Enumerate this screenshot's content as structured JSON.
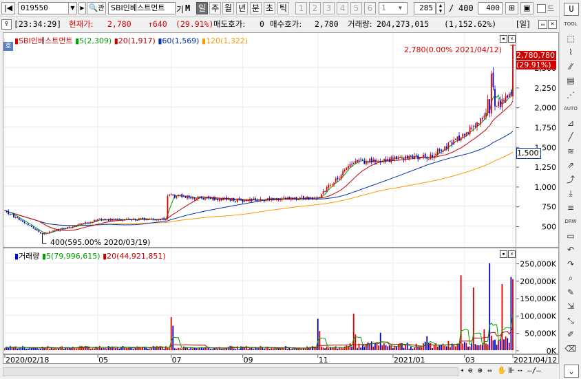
{
  "toolbar": {
    "code": "019550",
    "name": "SBI인베스트먼트",
    "name_tag": "기",
    "market_tag": "M",
    "periods": [
      "일",
      "주",
      "월",
      "년",
      "분",
      "초",
      "틱"
    ],
    "selected_period": "일",
    "interval_buttons": [
      "1",
      "2",
      "3",
      "4",
      "5",
      "6"
    ],
    "interval_value": "1",
    "view_count": "285",
    "view_total": "400",
    "view_max": "400"
  },
  "info": {
    "time": "[23:34:29]",
    "price_label": "현재가:",
    "price": "2,780",
    "change": "↑640",
    "change_pct": "(29.91%)",
    "ask_label": "매도호가:",
    "ask": "0",
    "bid_label": "매수호가:",
    "bid": "2,780",
    "volume_label": "거래량:",
    "volume": "204,273,015",
    "volume_pct": "(1,152.62%)",
    "period_tag": "[일]"
  },
  "price_legend": {
    "name": "SBI인베스트먼트",
    "ma5": "5(2,309)",
    "ma20": "20(1,917)",
    "ma60": "60(1,569)",
    "ma120": "120(1,322)",
    "badge": "호"
  },
  "volume_legend": {
    "name": "거래량",
    "ma5": "5(79,996,615)",
    "ma20": "20(44,921,851)"
  },
  "annotations": {
    "high": "2,780(0.00% 2021/04/12)",
    "low": "400(595.00% 2020/03/19)",
    "current_price_tag": "2,780,780",
    "current_pct_tag": "(29.91%)",
    "ma_tag": "1,500"
  },
  "x_labels": [
    "2020/02/18",
    "05",
    "07",
    "09",
    "11",
    "2021/01",
    "03",
    "2021/04/12"
  ],
  "colors": {
    "up": "#d40000",
    "down": "#0000cc",
    "ma5": "#00a000",
    "ma20": "#c00000",
    "ma60": "#0033aa",
    "ma120": "#ff9900"
  },
  "sidebar": [
    "TOOL",
    "zoom",
    "chart",
    "compare",
    "find",
    "trend",
    "AUTO",
    "indicator",
    "line",
    "pattern",
    "arrow",
    "fibo",
    "download",
    "list",
    "DRW",
    "window",
    "undo",
    "redo",
    "search",
    "draw",
    "zoom-out",
    "ruler",
    "stamp",
    "eraser"
  ],
  "chart_data": {
    "type": "candlestick",
    "title": "",
    "price_axis": {
      "ylim": [
        270,
        2900
      ],
      "ticks": [
        500,
        750,
        1000,
        1250,
        1500,
        1750,
        2000,
        2250,
        2500
      ]
    },
    "volume_axis": {
      "ylim": [
        0,
        265000000
      ],
      "ticks": [
        "0K",
        "50,000K",
        "100,000K",
        "150,000K",
        "200,000K",
        "250,000K"
      ]
    },
    "x_axis": {
      "labels": [
        "2020/02/18",
        "05",
        "07",
        "09",
        "11",
        "2021/01",
        "03",
        "2021/04/12"
      ]
    },
    "series": [
      {
        "name": "SBI인베스트먼트",
        "anchor_values": [
          {
            "date": "2020/02/18",
            "value": 690
          },
          {
            "date": "2020/03/19",
            "value": 400
          },
          {
            "date": "2020/05",
            "value": 580
          },
          {
            "date": "2020/06/25",
            "value": 590
          },
          {
            "date": "2020/07/01",
            "value": 880
          },
          {
            "date": "2020/09",
            "value": 820
          },
          {
            "date": "2020/11",
            "value": 860
          },
          {
            "date": "2020/12",
            "value": 1300
          },
          {
            "date": "2021/01",
            "value": 1340
          },
          {
            "date": "2021/02",
            "value": 1380
          },
          {
            "date": "2021/03",
            "value": 1650
          },
          {
            "date": "2021/04/09",
            "value": 2140
          },
          {
            "date": "2021/04/12",
            "value": 2780
          }
        ]
      },
      {
        "name": "5",
        "value": 2309
      },
      {
        "name": "20",
        "value": 1917
      },
      {
        "name": "60",
        "value": 1569
      },
      {
        "name": "120",
        "value": 1322
      }
    ]
  }
}
